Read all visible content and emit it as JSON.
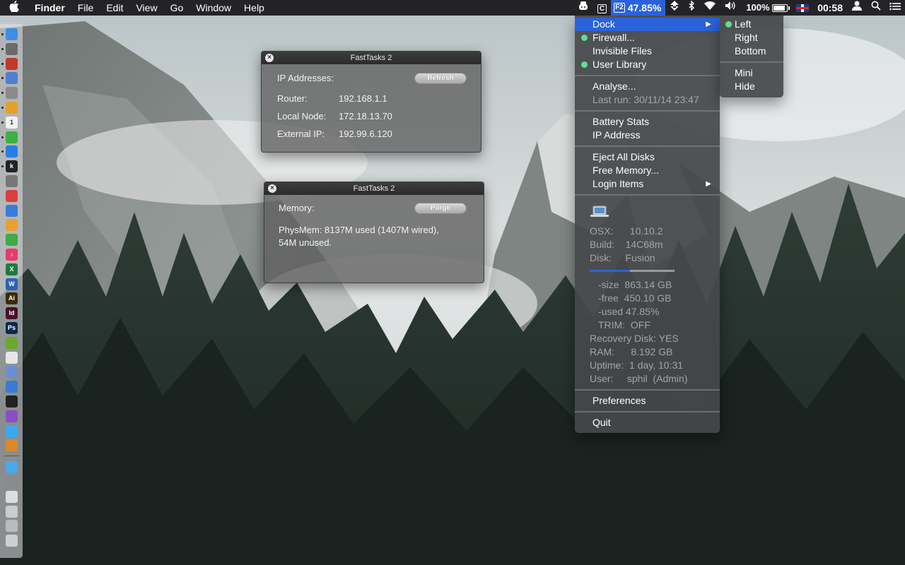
{
  "menubar": {
    "apple_glyph": "",
    "app_name": "Finder",
    "menus": [
      "File",
      "Edit",
      "View",
      "Go",
      "Window",
      "Help"
    ],
    "status": {
      "fasttasks_icon": "F2",
      "fasttasks_value": "47.85%",
      "c_icon": "C",
      "battery_percent": "100%",
      "battery_level": 1.0,
      "clock": "00:58"
    },
    "icons": [
      "app-hat-icon",
      "c-box-icon",
      "fasttasks-icon",
      "sync-icon",
      "bluetooth-icon",
      "wifi-icon",
      "volume-icon",
      "battery-icon",
      "uk-flag-icon",
      "user-icon",
      "spotlight-icon",
      "notification-list-icon"
    ]
  },
  "panel_ip": {
    "title": "FastTasks 2",
    "heading": "IP Addresses:",
    "button": "Refresh",
    "rows": [
      {
        "label": "Router:",
        "value": "192.168.1.1"
      },
      {
        "label": "Local Node:",
        "value": "172.18.13.70"
      },
      {
        "label": "External IP:",
        "value": "192.99.6.120"
      }
    ]
  },
  "panel_mem": {
    "title": "FastTasks 2",
    "heading": "Memory:",
    "button": "Purge",
    "line1": "PhysMem: 8137M used (1407M wired),",
    "line2": "54M unused."
  },
  "menu": {
    "dock": "Dock",
    "firewall": "Firewall...",
    "invisible_files": "Invisible Files",
    "user_library": "User Library",
    "analyse": "Analyse...",
    "last_run": "Last run: 30/11/14 23:47",
    "battery_stats": "Battery Stats",
    "ip_address": "IP Address",
    "eject_all": "Eject All Disks",
    "free_memory": "Free Memory...",
    "login_items": "Login Items",
    "preferences": "Preferences",
    "quit": "Quit",
    "disk_used_fraction": 0.4785,
    "info": {
      "osx": "OSX:      10.10.2",
      "build": "Build:    14C68m",
      "disk": "Disk:     Fusion",
      "size": "-size  863.14 GB",
      "free": "-free  450.10 GB",
      "used": "-used 47.85%",
      "trim": "TRIM:  OFF",
      "recovery": "Recovery Disk: YES",
      "ram": "RAM:      8.192 GB",
      "uptime": "Uptime:  1 day, 10:31",
      "user": "User:     sphil  (Admin)"
    }
  },
  "submenu": {
    "left": "Left",
    "right": "Right",
    "bottom": "Bottom",
    "mini": "Mini",
    "hide": "Hide"
  },
  "dock_icons": [
    {
      "name": "finder-icon",
      "color": "#3d8ee8",
      "glyph": ""
    },
    {
      "name": "launchpad-icon",
      "color": "#6b6b6b",
      "glyph": ""
    },
    {
      "name": "rocket-app-icon",
      "color": "#c0392b",
      "glyph": ""
    },
    {
      "name": "preview-icon",
      "color": "#4f7fd1",
      "glyph": ""
    },
    {
      "name": "drive-icon",
      "color": "#8a8a8a",
      "glyph": ""
    },
    {
      "name": "photos-icon",
      "color": "#e5a02a",
      "glyph": ""
    },
    {
      "name": "calendar-icon",
      "color": "#f2f2f2",
      "glyph": "1"
    },
    {
      "name": "evernote-icon",
      "color": "#3cb043",
      "glyph": ""
    },
    {
      "name": "safari-icon",
      "color": "#2a7de1",
      "glyph": ""
    },
    {
      "name": "kindle-icon",
      "color": "#222222",
      "glyph": "k"
    },
    {
      "name": "system-prefs-icon",
      "color": "#777777",
      "glyph": ""
    },
    {
      "name": "flashlight-app-icon",
      "color": "#d94040",
      "glyph": ""
    },
    {
      "name": "keynote-icon",
      "color": "#3b7bd8",
      "glyph": ""
    },
    {
      "name": "pages-icon",
      "color": "#e8a030",
      "glyph": ""
    },
    {
      "name": "numbers-icon",
      "color": "#3faa4a",
      "glyph": ""
    },
    {
      "name": "itunes-icon",
      "color": "#e83a6a",
      "glyph": "♪"
    },
    {
      "name": "excel-icon",
      "color": "#1e7a3c",
      "glyph": "X"
    },
    {
      "name": "word-icon",
      "color": "#2a62b8",
      "glyph": "W"
    },
    {
      "name": "illustrator-icon",
      "color": "#3d2a00",
      "glyph": "Ai"
    },
    {
      "name": "indesign-icon",
      "color": "#4a0f2e",
      "glyph": "Id"
    },
    {
      "name": "photoshop-icon",
      "color": "#0a2a4a",
      "glyph": "Ps"
    },
    {
      "name": "coda-icon",
      "color": "#6aa832",
      "glyph": ""
    },
    {
      "name": "textedit-icon",
      "color": "#e6e6e6",
      "glyph": ""
    },
    {
      "name": "mail-icon",
      "color": "#6a8fd0",
      "glyph": ""
    },
    {
      "name": "xcode-icon",
      "color": "#3a7bd5",
      "glyph": ""
    },
    {
      "name": "terminal-icon",
      "color": "#222222",
      "glyph": ""
    },
    {
      "name": "onepassword-icon",
      "color": "#8a4ec7",
      "glyph": ""
    },
    {
      "name": "messages-icon",
      "color": "#3aa8f0",
      "glyph": ""
    },
    {
      "name": "package-icon",
      "color": "#d98a2a",
      "glyph": ""
    },
    {
      "name": "folder-icon",
      "color": "#4aa8e8",
      "glyph": ""
    },
    {
      "name": "screen-icon",
      "color": "#8a8a8a",
      "glyph": ""
    },
    {
      "name": "document-icon",
      "color": "#dddddd",
      "glyph": ""
    },
    {
      "name": "stack-icon",
      "color": "#cccccc",
      "glyph": ""
    },
    {
      "name": "downloads-icon",
      "color": "#bbbbbb",
      "glyph": ""
    },
    {
      "name": "trash-icon",
      "color": "#cfcfcf",
      "glyph": ""
    }
  ]
}
